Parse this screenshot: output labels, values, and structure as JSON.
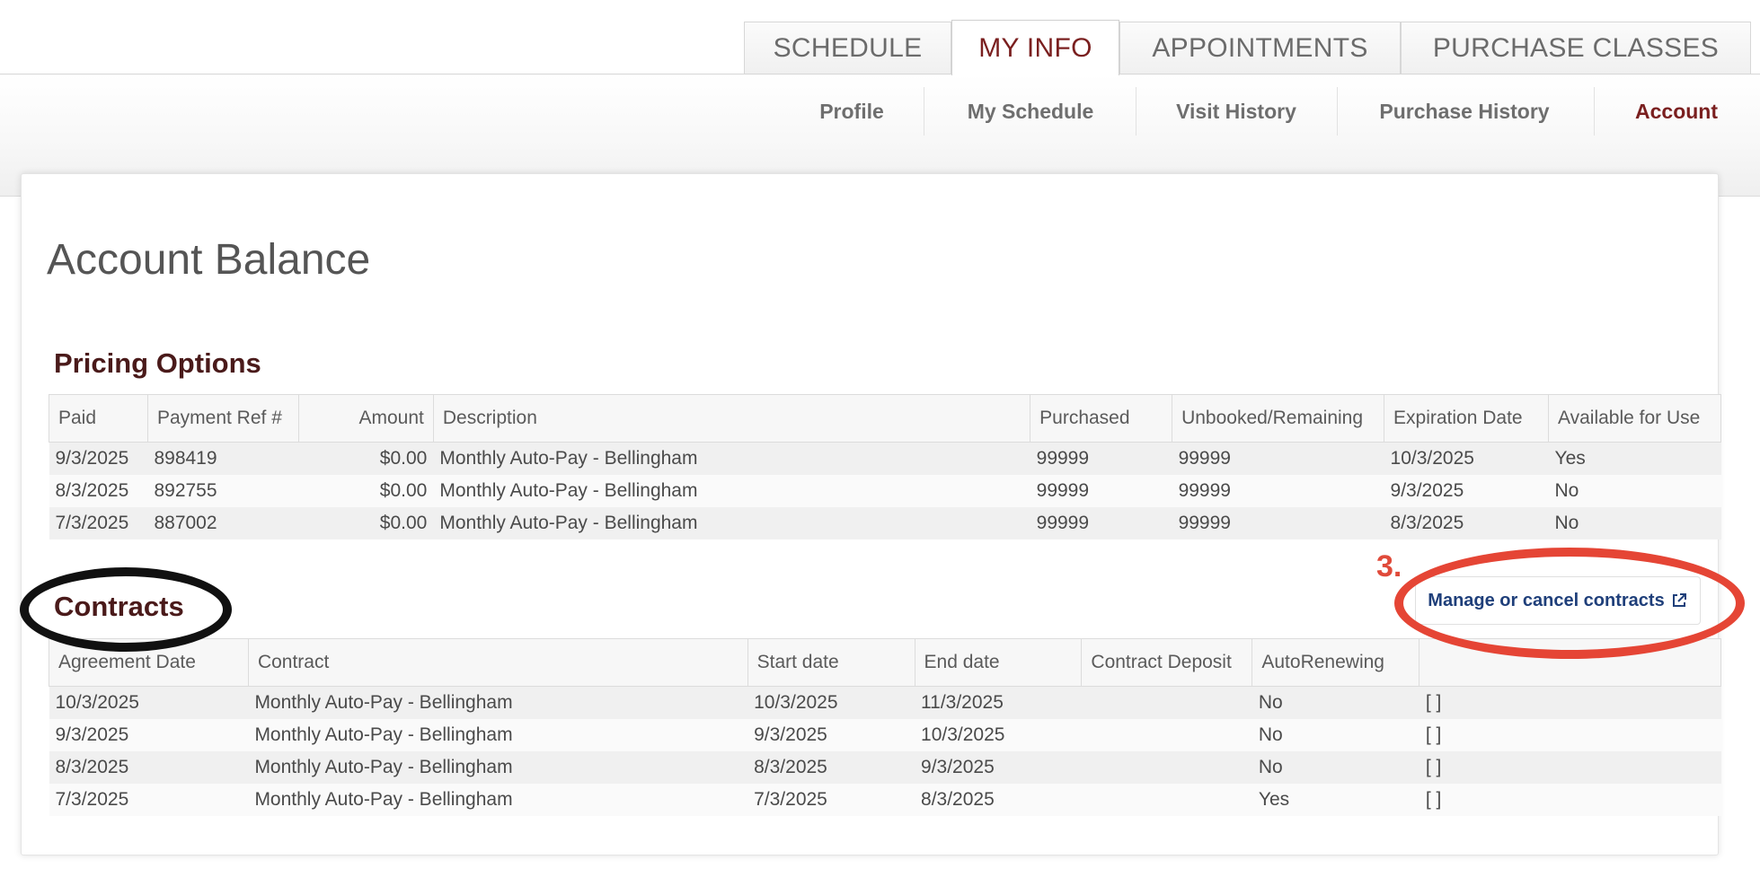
{
  "tabs": [
    {
      "label": "SCHEDULE",
      "active": false
    },
    {
      "label": "MY INFO",
      "active": true
    },
    {
      "label": "APPOINTMENTS",
      "active": false
    },
    {
      "label": "PURCHASE CLASSES",
      "active": false
    }
  ],
  "subnav": [
    {
      "label": "Profile",
      "active": false
    },
    {
      "label": "My Schedule",
      "active": false
    },
    {
      "label": "Visit History",
      "active": false
    },
    {
      "label": "Purchase History",
      "active": false
    },
    {
      "label": "Account",
      "active": true
    }
  ],
  "page_title": "Account Balance",
  "pricing": {
    "title": "Pricing Options",
    "columns": [
      "Paid",
      "Payment Ref #",
      "Amount",
      "Description",
      "Purchased",
      "Unbooked/Remaining",
      "Expiration Date",
      "Available for Use"
    ],
    "rows": [
      [
        "9/3/2025",
        "898419",
        "$0.00",
        "Monthly Auto-Pay - Bellingham",
        "99999",
        "99999",
        "10/3/2025",
        "Yes"
      ],
      [
        "8/3/2025",
        "892755",
        "$0.00",
        "Monthly Auto-Pay - Bellingham",
        "99999",
        "99999",
        "9/3/2025",
        "No"
      ],
      [
        "7/3/2025",
        "887002",
        "$0.00",
        "Monthly Auto-Pay - Bellingham",
        "99999",
        "99999",
        "8/3/2025",
        "No"
      ]
    ]
  },
  "contracts": {
    "title": "Contracts",
    "manage_label": "Manage or cancel contracts",
    "columns": [
      "Agreement Date",
      "Contract",
      "Start date",
      "End date",
      "Contract Deposit",
      "AutoRenewing",
      ""
    ],
    "rows": [
      [
        "10/3/2025",
        "Monthly Auto-Pay - Bellingham",
        "10/3/2025",
        "11/3/2025",
        "",
        "No",
        "[ ]"
      ],
      [
        "9/3/2025",
        "Monthly Auto-Pay - Bellingham",
        "9/3/2025",
        "10/3/2025",
        "",
        "No",
        "[ ]"
      ],
      [
        "8/3/2025",
        "Monthly Auto-Pay - Bellingham",
        "8/3/2025",
        "9/3/2025",
        "",
        "No",
        "[ ]"
      ],
      [
        "7/3/2025",
        "Monthly Auto-Pay - Bellingham",
        "7/3/2025",
        "8/3/2025",
        "",
        "Yes",
        "[ ]"
      ]
    ]
  },
  "annotation": {
    "step_label": "3.",
    "ellipse_contracts_color": "#111111",
    "ellipse_manage_color": "#e54535"
  },
  "colors": {
    "accent": "#7a1f1f",
    "link": "#1f3f7a",
    "section_heading": "#4a1a1a"
  }
}
